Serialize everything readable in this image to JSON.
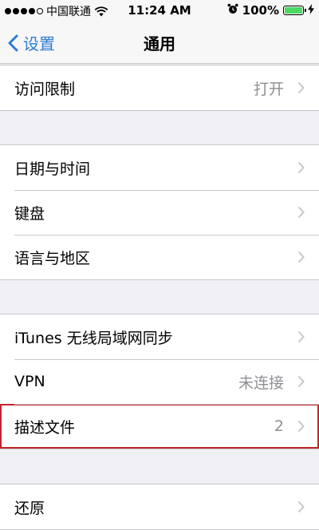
{
  "status_bar": {
    "carrier": "中国联通",
    "time": "11:24 AM",
    "battery_percent_text": "100%",
    "battery_level": 1.0,
    "icons": [
      "signal-dots-icon",
      "wifi-icon",
      "alarm-clock-icon",
      "battery-icon",
      "charging-bolt-icon"
    ]
  },
  "nav": {
    "back_label": "设置",
    "title": "通用"
  },
  "groups": [
    {
      "rows": [
        {
          "label": "访问限制",
          "value": "打开"
        }
      ]
    },
    {
      "rows": [
        {
          "label": "日期与时间",
          "value": ""
        },
        {
          "label": "键盘",
          "value": ""
        },
        {
          "label": "语言与地区",
          "value": ""
        }
      ]
    },
    {
      "rows": [
        {
          "label": "iTunes 无线局域网同步",
          "value": ""
        },
        {
          "label": "VPN",
          "value": "未连接"
        },
        {
          "label": "描述文件",
          "value": "2",
          "highlighted": true
        }
      ]
    },
    {
      "rows": [
        {
          "label": "还原",
          "value": ""
        }
      ]
    }
  ],
  "colors": {
    "accent": "#2e7bd6",
    "background": "#efeff4",
    "highlight_border": "#c0262c",
    "battery_fill": "#4cd964"
  }
}
